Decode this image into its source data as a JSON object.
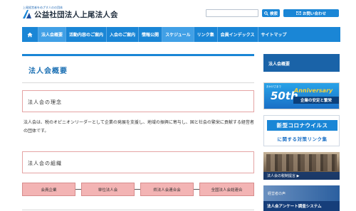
{
  "header": {
    "tagline": "上尾経営者をめざす人のの団体",
    "site_name": "公益社団法人上尾法人会",
    "search_placeholder": "",
    "search_button": "検索",
    "inquiry_button": "お問い合わせ"
  },
  "nav": {
    "home_icon": "home-icon",
    "items": [
      {
        "label": "法人会概要",
        "active": true
      },
      {
        "label": "活動内容のご案内",
        "active": false
      },
      {
        "label": "入会のご案内",
        "active": false
      },
      {
        "label": "情報公開",
        "active": false
      },
      {
        "label": "スケジュール",
        "active": true
      },
      {
        "label": "リンク集",
        "active": false
      },
      {
        "label": "会員インデックス",
        "active": false
      },
      {
        "label": "サイトマップ",
        "active": false
      }
    ]
  },
  "main": {
    "page_title": "法人会概要",
    "philosophy_heading": "法人会の理念",
    "philosophy_body": "法人会は、税のオピニオンリーダーとして企業の発展を支援し、地域の振興に寄与し、国と社会の繁栄に貢献する経営者の団体です。",
    "organization_heading": "法人会の組織",
    "org_chart": [
      "会員企業",
      "単位法人会",
      "県法人会連合会",
      "全国法人会総連合"
    ]
  },
  "sidebar": {
    "title": "法人会概要",
    "banners": {
      "anniversary": {
        "small": "おかげさまで",
        "number": "50th",
        "word": "Anniversary",
        "subtitle": "企業の安定と繁栄"
      },
      "corona": {
        "top": "新型コロナウイルス",
        "bottom": "に関する対策リンク集"
      },
      "proposal": {
        "label": "法人会の税制提言 ▶"
      },
      "voice": {
        "top": "経営者の声",
        "bottom": "法人会アンケート調査システム"
      }
    }
  },
  "colors": {
    "primary": "#1a86d6",
    "sidebar_head": "#1a63a8",
    "org_box": "#f3b4b4",
    "section_border": "#e5a4a4"
  }
}
